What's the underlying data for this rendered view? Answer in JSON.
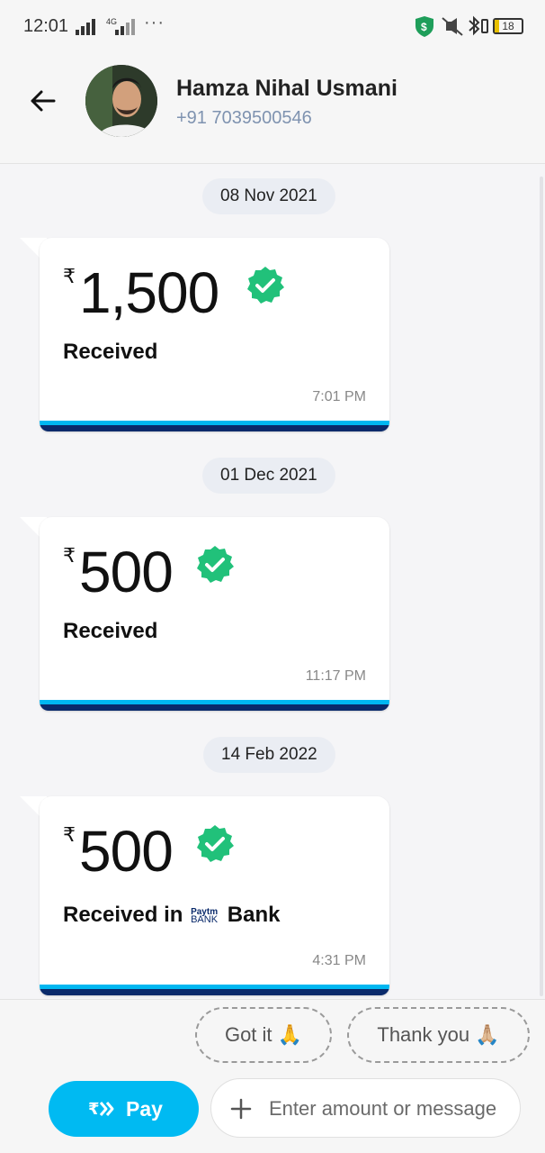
{
  "status_bar": {
    "time": "12:01",
    "network": "4G",
    "battery": "18",
    "battery_level": 0.18
  },
  "header": {
    "contact_name": "Hamza Nihal Usmani",
    "contact_phone": "+91 7039500546"
  },
  "transactions": [
    {
      "date": "08 Nov 2021",
      "currency": "₹",
      "amount": "1,500",
      "status": "Received",
      "time": "7:01 PM"
    },
    {
      "date": "01 Dec 2021",
      "currency": "₹",
      "amount": "500",
      "status": "Received",
      "time": "11:17 PM"
    },
    {
      "date": "14 Feb 2022",
      "currency": "₹",
      "amount": "500",
      "status_prefix": "Received in",
      "bank_logo_top": "Paytm",
      "bank_logo_bottom": "BANK",
      "status_suffix": "Bank",
      "time": "4:31 PM"
    }
  ],
  "quick_replies": [
    {
      "label": "Got it 🙏"
    },
    {
      "label": "Thank you 🙏🏼"
    }
  ],
  "composer": {
    "pay_label": "Pay",
    "placeholder": "Enter amount or message"
  },
  "colors": {
    "accent": "#00baf2",
    "brand_dark": "#0a2a6b",
    "verified": "#21c17a",
    "phone_text": "#7f93b0"
  }
}
